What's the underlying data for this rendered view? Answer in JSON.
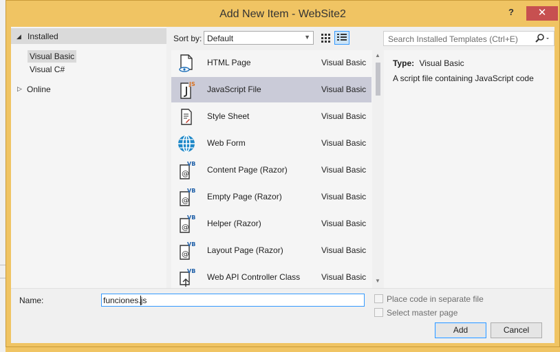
{
  "window": {
    "title": "Add New Item - WebSite2",
    "help_label": "?",
    "close_label": "✕"
  },
  "tree": {
    "installed_label": "Installed",
    "items": [
      {
        "label": "Visual Basic",
        "selected": true
      },
      {
        "label": "Visual C#",
        "selected": false
      }
    ],
    "online_label": "Online"
  },
  "toolbar": {
    "sort_by_label": "Sort by:",
    "sort_value": "Default",
    "search_placeholder": "Search Installed Templates (Ctrl+E)"
  },
  "templates": [
    {
      "name": "HTML Page",
      "lang": "Visual Basic",
      "icon": "html-page-icon",
      "selected": false
    },
    {
      "name": "JavaScript File",
      "lang": "Visual Basic",
      "icon": "javascript-file-icon",
      "selected": true
    },
    {
      "name": "Style Sheet",
      "lang": "Visual Basic",
      "icon": "style-sheet-icon",
      "selected": false
    },
    {
      "name": "Web Form",
      "lang": "Visual Basic",
      "icon": "web-form-globe-icon",
      "selected": false
    },
    {
      "name": "Content Page (Razor)",
      "lang": "Visual Basic",
      "icon": "razor-vb-icon",
      "selected": false
    },
    {
      "name": "Empty Page (Razor)",
      "lang": "Visual Basic",
      "icon": "razor-vb-icon",
      "selected": false
    },
    {
      "name": "Helper (Razor)",
      "lang": "Visual Basic",
      "icon": "razor-vb-icon",
      "selected": false
    },
    {
      "name": "Layout Page (Razor)",
      "lang": "Visual Basic",
      "icon": "razor-vb-icon",
      "selected": false
    },
    {
      "name": "Web API Controller Class",
      "lang": "Visual Basic",
      "icon": "webapi-vb-icon",
      "selected": false
    }
  ],
  "details": {
    "type_label": "Type:",
    "type_value": "Visual Basic",
    "description": "A script file containing JavaScript code"
  },
  "bottom": {
    "name_label": "Name:",
    "name_value": "funciones.js",
    "place_code_label": "Place code in separate file",
    "select_master_label": "Select master page",
    "add_label": "Add",
    "cancel_label": "Cancel"
  },
  "colors": {
    "frame": "#f0c463",
    "close": "#c75050",
    "selection": "#cacbd8",
    "accent": "#3399ff"
  }
}
